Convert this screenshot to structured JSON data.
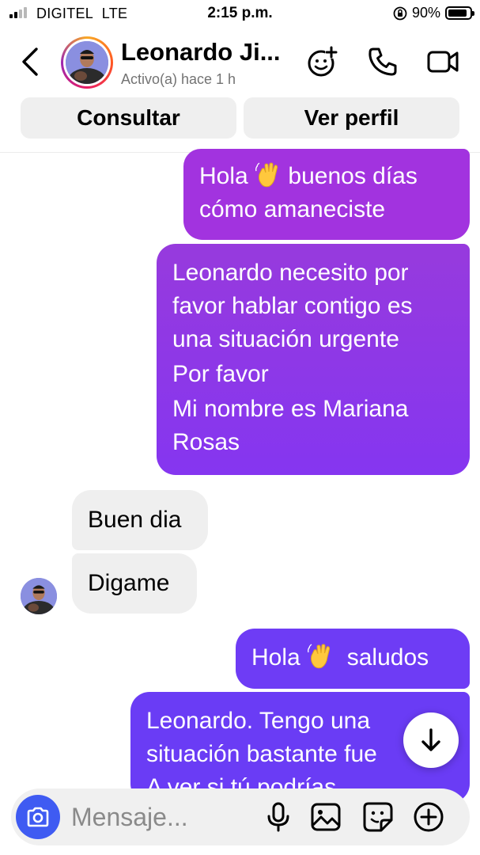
{
  "status_bar": {
    "carrier": "DIGITEL",
    "network": "LTE",
    "time": "2:15 p.m.",
    "battery_percent": "90%",
    "battery_level": 0.9
  },
  "header": {
    "contact_name": "Leonardo Ji...",
    "contact_status": "Activo(a) hace 1 h",
    "icons": [
      "back-icon",
      "sticker-add-icon",
      "phone-icon",
      "video-icon"
    ]
  },
  "actions": {
    "consult_label": "Consultar",
    "profile_label": "Ver perfil"
  },
  "messages": [
    {
      "direction": "outgoing",
      "lines": [
        "Hola",
        "buenos días",
        "cómo amaneciste"
      ]
    },
    {
      "direction": "outgoing",
      "lines": [
        "Leonardo necesito por",
        "favor hablar contigo es",
        "una situación urgente",
        "Por favor",
        "Mi nombre es Mariana",
        "Rosas"
      ]
    },
    {
      "direction": "incoming",
      "lines": [
        "Buen dia"
      ]
    },
    {
      "direction": "incoming",
      "lines": [
        "Digame"
      ]
    },
    {
      "direction": "outgoing",
      "lines": [
        "Hola",
        "saludos"
      ]
    },
    {
      "direction": "outgoing",
      "lines": [
        "Leonardo. Tengo una",
        "situación bastante fue",
        "A ver si tú podrías"
      ]
    }
  ],
  "composer": {
    "placeholder": "Mensaje...",
    "icons": [
      "camera-icon",
      "microphone-icon",
      "gallery-icon",
      "sticker-icon",
      "plus-icon"
    ]
  },
  "colors": {
    "bubble_top": "#a233df",
    "bubble_mid": "#8a35ee",
    "bubble_bottom": "#6a3cf5",
    "incoming_bubble": "#efefef",
    "camera_button": "#3f5bf2"
  }
}
